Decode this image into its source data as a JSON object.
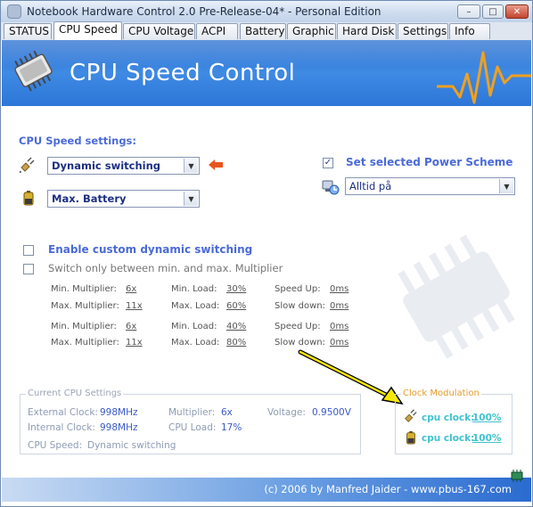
{
  "window": {
    "title": "Notebook Hardware Control 2.0 Pre-Release-04*  - Personal Edition",
    "controls": {
      "minimize": "–",
      "maximize": "□",
      "close": "✕"
    }
  },
  "tabs": [
    {
      "label": "STATUS",
      "active": false
    },
    {
      "label": "CPU Speed",
      "active": true
    },
    {
      "label": "CPU Voltage",
      "active": false
    },
    {
      "label": "ACPI",
      "active": false
    },
    {
      "label": "Battery",
      "active": false
    },
    {
      "label": "Graphic",
      "active": false
    },
    {
      "label": "Hard Disk",
      "active": false
    },
    {
      "label": "Settings",
      "active": false
    },
    {
      "label": "Info",
      "active": false
    }
  ],
  "banner": {
    "title": "CPU Speed Control",
    "icon": "cpu-chip-icon",
    "accent": "#f0a020"
  },
  "speed_settings": {
    "heading": "CPU Speed settings:",
    "mode_value": "Dynamic switching",
    "profile_value": "Max. Battery",
    "set_power_scheme_label": "Set selected Power Scheme",
    "set_power_scheme_checked": true,
    "power_scheme_value": "Alltid på",
    "arrow_icon": "arrow-left-icon"
  },
  "custom": {
    "enable_label": "Enable custom dynamic switching",
    "enable_checked": false,
    "switch_only_label": "Switch only between min. and max. Multiplier",
    "switch_only_checked": false
  },
  "grid": {
    "labels": {
      "min_mult": "Min. Multiplier:",
      "max_mult": "Max. Multiplier:",
      "min_load": "Min. Load:",
      "max_load": "Max. Load:",
      "speed_up": "Speed Up:",
      "slow_down": "Slow down:"
    },
    "rows": [
      {
        "mult": "6x",
        "load": "30%",
        "time": "0ms"
      },
      {
        "mult": "11x",
        "load": "60%",
        "time": "0ms"
      },
      {
        "mult": "6x",
        "load": "40%",
        "time": "0ms"
      },
      {
        "mult": "11x",
        "load": "80%",
        "time": "0ms"
      }
    ]
  },
  "current": {
    "title": "Current CPU Settings",
    "external_clock_label": "External Clock:",
    "external_clock": "998MHz",
    "internal_clock_label": "Internal Clock:",
    "internal_clock": "998MHz",
    "multiplier_label": "Multiplier:",
    "multiplier": "6x",
    "cpu_load_label": "CPU Load:",
    "cpu_load": "17%",
    "voltage_label": "Voltage:",
    "voltage": "0.9500V",
    "cpu_speed_label": "CPU Speed:",
    "cpu_speed": "Dynamic switching"
  },
  "clock_modulation": {
    "title": "Clock Modulation",
    "items": [
      {
        "label": "cpu clock:",
        "value": "100%",
        "icon": "plug-icon"
      },
      {
        "label": "cpu clock:",
        "value": "100%",
        "icon": "battery-icon"
      }
    ]
  },
  "footer": {
    "text": "(c) 2006 by Manfred Jaider  -  www.pbus-167.com",
    "icon": "chip-tray-icon"
  }
}
